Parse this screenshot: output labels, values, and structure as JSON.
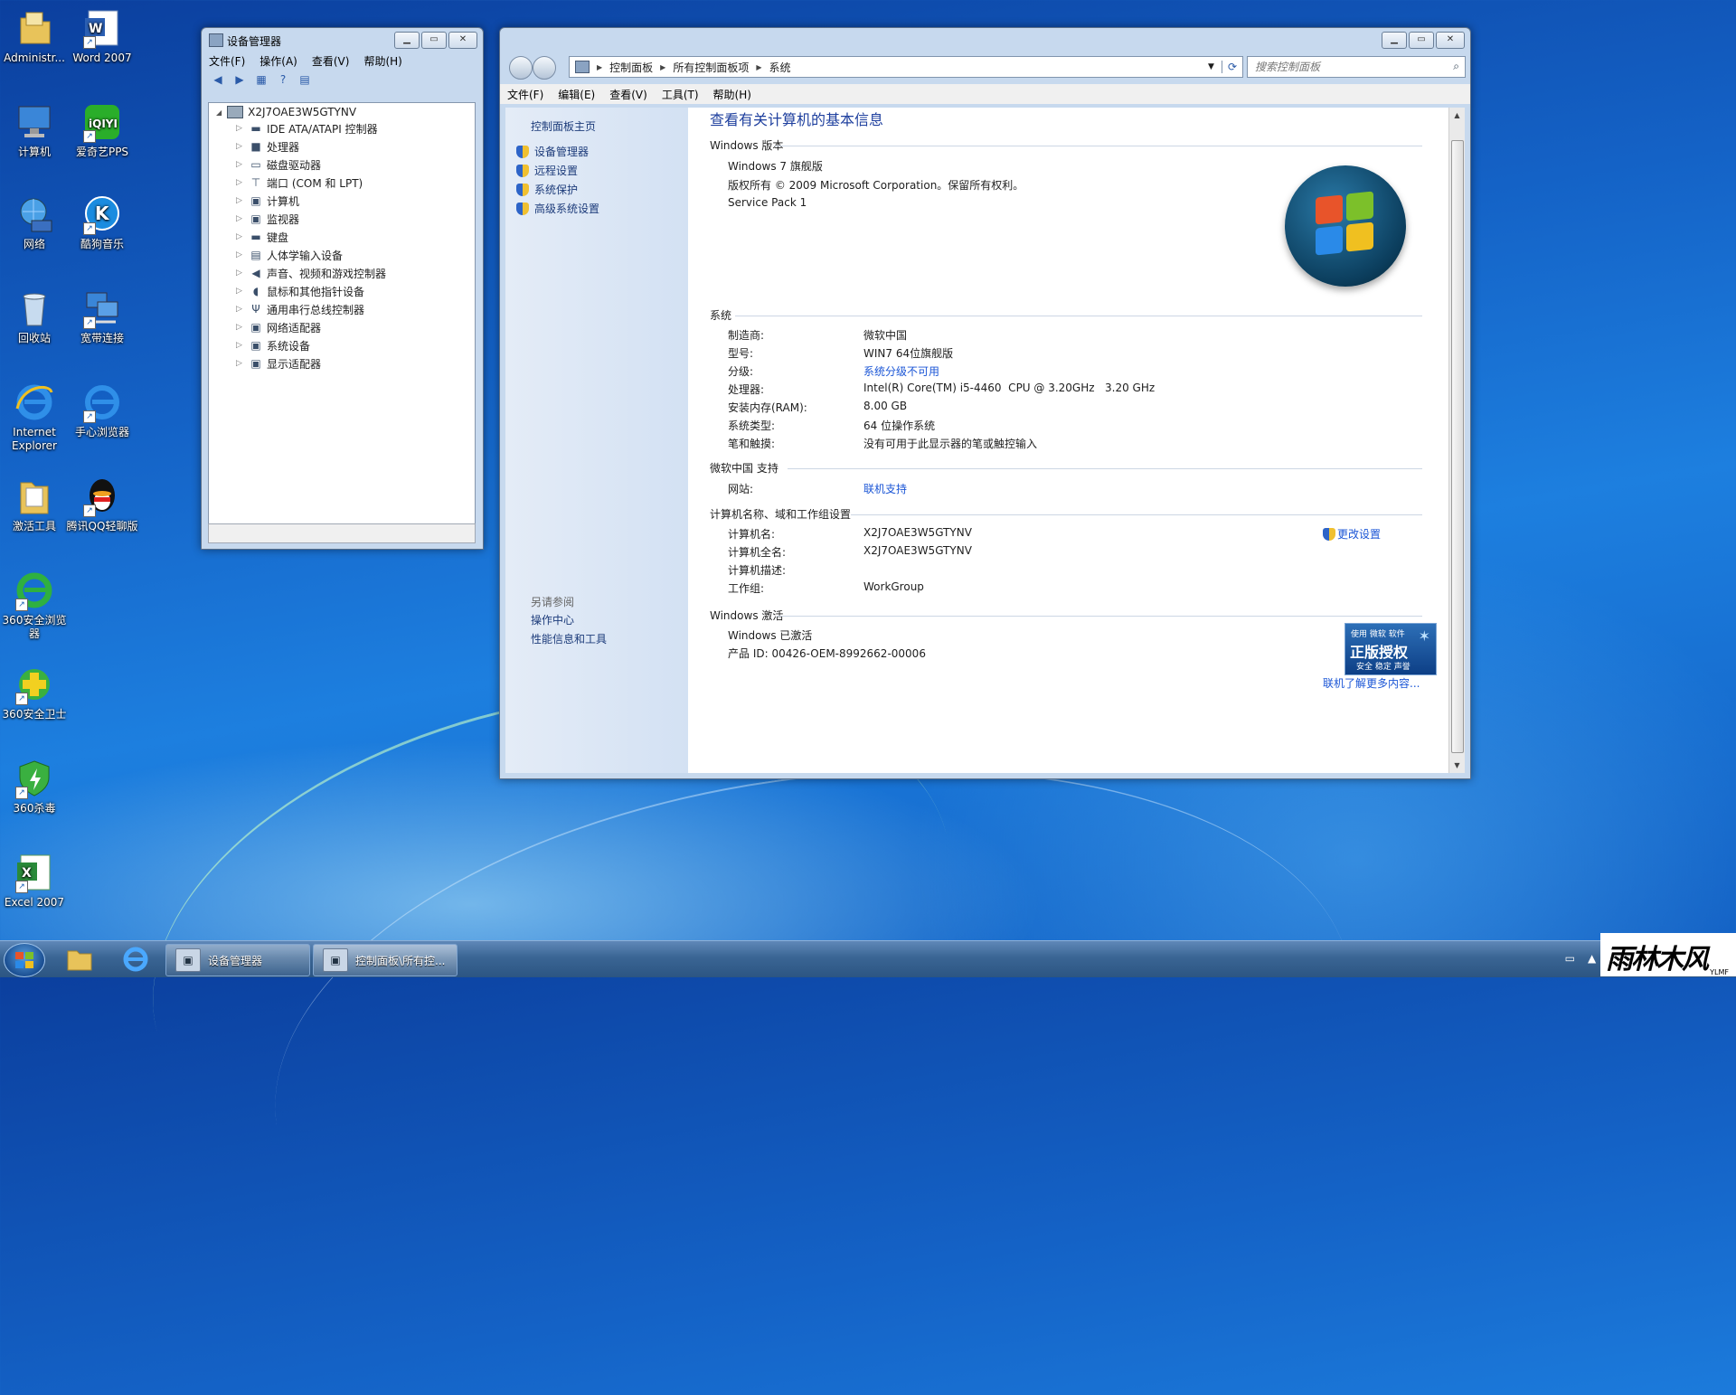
{
  "desktop": {
    "icons": [
      {
        "label": "Administr...",
        "icon": "user-folder-icon"
      },
      {
        "label": "Word 2007",
        "icon": "word-icon"
      },
      {
        "label": "计算机",
        "icon": "computer-icon"
      },
      {
        "label": "爱奇艺PPS",
        "icon": "iqiyi-icon"
      },
      {
        "label": "网络",
        "icon": "network-icon"
      },
      {
        "label": "酷狗音乐",
        "icon": "kugou-icon"
      },
      {
        "label": "回收站",
        "icon": "recycle-bin-icon"
      },
      {
        "label": "宽带连接",
        "icon": "broadband-icon"
      },
      {
        "label": "Internet Explorer",
        "icon": "ie-icon"
      },
      {
        "label": "手心浏览器",
        "icon": "browser-icon"
      },
      {
        "label": "激活工具",
        "icon": "folder-icon"
      },
      {
        "label": "腾讯QQ轻聊版",
        "icon": "qq-icon"
      },
      {
        "label": "360安全浏览器",
        "icon": "360-browser-icon"
      },
      {
        "label": "360安全卫士",
        "icon": "360-guard-icon"
      },
      {
        "label": "360杀毒",
        "icon": "360-antivirus-icon"
      },
      {
        "label": "Excel 2007",
        "icon": "excel-icon"
      }
    ]
  },
  "devmgr": {
    "title": "设备管理器",
    "menu": [
      "文件(F)",
      "操作(A)",
      "查看(V)",
      "帮助(H)"
    ],
    "root": "X2J7OAE3W5GTYNV",
    "items": [
      "IDE ATA/ATAPI 控制器",
      "处理器",
      "磁盘驱动器",
      "端口 (COM 和 LPT)",
      "计算机",
      "监视器",
      "键盘",
      "人体学输入设备",
      "声音、视频和游戏控制器",
      "鼠标和其他指针设备",
      "通用串行总线控制器",
      "网络适配器",
      "系统设备",
      "显示适配器"
    ]
  },
  "cp": {
    "breadcrumb": [
      "控制面板",
      "所有控制面板项",
      "系统"
    ],
    "search_placeholder": "搜索控制面板",
    "menu": [
      "文件(F)",
      "编辑(E)",
      "查看(V)",
      "工具(T)",
      "帮助(H)"
    ],
    "side": {
      "home": "控制面板主页",
      "links": [
        "设备管理器",
        "远程设置",
        "系统保护",
        "高级系统设置"
      ],
      "see_also": "另请参阅",
      "bottom_links": [
        "操作中心",
        "性能信息和工具"
      ]
    },
    "heading": "查看有关计算机的基本信息",
    "edition": {
      "section": "Windows 版本",
      "name": "Windows 7 旗舰版",
      "copyright": "版权所有 © 2009 Microsoft Corporation。保留所有权利。",
      "sp": "Service Pack 1"
    },
    "system": {
      "section": "系统",
      "rows": [
        {
          "label": "制造商:",
          "value": "微软中国"
        },
        {
          "label": "型号:",
          "value": "WIN7 64位旗舰版"
        },
        {
          "label": "分级:",
          "value": "系统分级不可用"
        },
        {
          "label": "处理器:",
          "value": "Intel(R) Core(TM) i5-4460  CPU @ 3.20GHz   3.20 GHz"
        },
        {
          "label": "安装内存(RAM):",
          "value": "8.00 GB"
        },
        {
          "label": "系统类型:",
          "value": "64 位操作系统"
        },
        {
          "label": "笔和触摸:",
          "value": "没有可用于此显示器的笔或触控输入"
        }
      ]
    },
    "support": {
      "section": "微软中国 支持",
      "label": "网站:",
      "value": "联机支持"
    },
    "computer": {
      "section": "计算机名称、域和工作组设置",
      "change": "更改设置",
      "rows": [
        {
          "label": "计算机名:",
          "value": "X2J7OAE3W5GTYNV"
        },
        {
          "label": "计算机全名:",
          "value": "X2J7OAE3W5GTYNV"
        },
        {
          "label": "计算机描述:",
          "value": ""
        },
        {
          "label": "工作组:",
          "value": "WorkGroup"
        }
      ]
    },
    "activation": {
      "section": "Windows 激活",
      "status": "Windows 已激活",
      "product_id": "产品 ID: 00426-OEM-8992662-00006",
      "badge_top": "使用 微软 软件",
      "badge_main": "正版授权",
      "badge_bottom": "安全 稳定 声誉",
      "more": "联机了解更多内容..."
    }
  },
  "taskbar": {
    "tasks": [
      "设备管理器",
      "控制面板\\所有控..."
    ]
  },
  "watermark": {
    "main": "雨林木风",
    "sub": "YLMF"
  }
}
